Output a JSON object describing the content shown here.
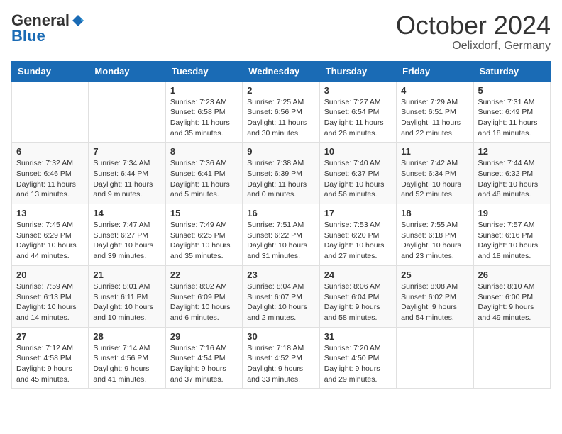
{
  "header": {
    "logo_general": "General",
    "logo_blue": "Blue",
    "month_title": "October 2024",
    "location": "Oelixdorf, Germany"
  },
  "weekdays": [
    "Sunday",
    "Monday",
    "Tuesday",
    "Wednesday",
    "Thursday",
    "Friday",
    "Saturday"
  ],
  "weeks": [
    [
      {
        "day": "",
        "sunrise": "",
        "sunset": "",
        "daylight": ""
      },
      {
        "day": "",
        "sunrise": "",
        "sunset": "",
        "daylight": ""
      },
      {
        "day": "1",
        "sunrise": "Sunrise: 7:23 AM",
        "sunset": "Sunset: 6:58 PM",
        "daylight": "Daylight: 11 hours and 35 minutes."
      },
      {
        "day": "2",
        "sunrise": "Sunrise: 7:25 AM",
        "sunset": "Sunset: 6:56 PM",
        "daylight": "Daylight: 11 hours and 30 minutes."
      },
      {
        "day": "3",
        "sunrise": "Sunrise: 7:27 AM",
        "sunset": "Sunset: 6:54 PM",
        "daylight": "Daylight: 11 hours and 26 minutes."
      },
      {
        "day": "4",
        "sunrise": "Sunrise: 7:29 AM",
        "sunset": "Sunset: 6:51 PM",
        "daylight": "Daylight: 11 hours and 22 minutes."
      },
      {
        "day": "5",
        "sunrise": "Sunrise: 7:31 AM",
        "sunset": "Sunset: 6:49 PM",
        "daylight": "Daylight: 11 hours and 18 minutes."
      }
    ],
    [
      {
        "day": "6",
        "sunrise": "Sunrise: 7:32 AM",
        "sunset": "Sunset: 6:46 PM",
        "daylight": "Daylight: 11 hours and 13 minutes."
      },
      {
        "day": "7",
        "sunrise": "Sunrise: 7:34 AM",
        "sunset": "Sunset: 6:44 PM",
        "daylight": "Daylight: 11 hours and 9 minutes."
      },
      {
        "day": "8",
        "sunrise": "Sunrise: 7:36 AM",
        "sunset": "Sunset: 6:41 PM",
        "daylight": "Daylight: 11 hours and 5 minutes."
      },
      {
        "day": "9",
        "sunrise": "Sunrise: 7:38 AM",
        "sunset": "Sunset: 6:39 PM",
        "daylight": "Daylight: 11 hours and 0 minutes."
      },
      {
        "day": "10",
        "sunrise": "Sunrise: 7:40 AM",
        "sunset": "Sunset: 6:37 PM",
        "daylight": "Daylight: 10 hours and 56 minutes."
      },
      {
        "day": "11",
        "sunrise": "Sunrise: 7:42 AM",
        "sunset": "Sunset: 6:34 PM",
        "daylight": "Daylight: 10 hours and 52 minutes."
      },
      {
        "day": "12",
        "sunrise": "Sunrise: 7:44 AM",
        "sunset": "Sunset: 6:32 PM",
        "daylight": "Daylight: 10 hours and 48 minutes."
      }
    ],
    [
      {
        "day": "13",
        "sunrise": "Sunrise: 7:45 AM",
        "sunset": "Sunset: 6:29 PM",
        "daylight": "Daylight: 10 hours and 44 minutes."
      },
      {
        "day": "14",
        "sunrise": "Sunrise: 7:47 AM",
        "sunset": "Sunset: 6:27 PM",
        "daylight": "Daylight: 10 hours and 39 minutes."
      },
      {
        "day": "15",
        "sunrise": "Sunrise: 7:49 AM",
        "sunset": "Sunset: 6:25 PM",
        "daylight": "Daylight: 10 hours and 35 minutes."
      },
      {
        "day": "16",
        "sunrise": "Sunrise: 7:51 AM",
        "sunset": "Sunset: 6:22 PM",
        "daylight": "Daylight: 10 hours and 31 minutes."
      },
      {
        "day": "17",
        "sunrise": "Sunrise: 7:53 AM",
        "sunset": "Sunset: 6:20 PM",
        "daylight": "Daylight: 10 hours and 27 minutes."
      },
      {
        "day": "18",
        "sunrise": "Sunrise: 7:55 AM",
        "sunset": "Sunset: 6:18 PM",
        "daylight": "Daylight: 10 hours and 23 minutes."
      },
      {
        "day": "19",
        "sunrise": "Sunrise: 7:57 AM",
        "sunset": "Sunset: 6:16 PM",
        "daylight": "Daylight: 10 hours and 18 minutes."
      }
    ],
    [
      {
        "day": "20",
        "sunrise": "Sunrise: 7:59 AM",
        "sunset": "Sunset: 6:13 PM",
        "daylight": "Daylight: 10 hours and 14 minutes."
      },
      {
        "day": "21",
        "sunrise": "Sunrise: 8:01 AM",
        "sunset": "Sunset: 6:11 PM",
        "daylight": "Daylight: 10 hours and 10 minutes."
      },
      {
        "day": "22",
        "sunrise": "Sunrise: 8:02 AM",
        "sunset": "Sunset: 6:09 PM",
        "daylight": "Daylight: 10 hours and 6 minutes."
      },
      {
        "day": "23",
        "sunrise": "Sunrise: 8:04 AM",
        "sunset": "Sunset: 6:07 PM",
        "daylight": "Daylight: 10 hours and 2 minutes."
      },
      {
        "day": "24",
        "sunrise": "Sunrise: 8:06 AM",
        "sunset": "Sunset: 6:04 PM",
        "daylight": "Daylight: 9 hours and 58 minutes."
      },
      {
        "day": "25",
        "sunrise": "Sunrise: 8:08 AM",
        "sunset": "Sunset: 6:02 PM",
        "daylight": "Daylight: 9 hours and 54 minutes."
      },
      {
        "day": "26",
        "sunrise": "Sunrise: 8:10 AM",
        "sunset": "Sunset: 6:00 PM",
        "daylight": "Daylight: 9 hours and 49 minutes."
      }
    ],
    [
      {
        "day": "27",
        "sunrise": "Sunrise: 7:12 AM",
        "sunset": "Sunset: 4:58 PM",
        "daylight": "Daylight: 9 hours and 45 minutes."
      },
      {
        "day": "28",
        "sunrise": "Sunrise: 7:14 AM",
        "sunset": "Sunset: 4:56 PM",
        "daylight": "Daylight: 9 hours and 41 minutes."
      },
      {
        "day": "29",
        "sunrise": "Sunrise: 7:16 AM",
        "sunset": "Sunset: 4:54 PM",
        "daylight": "Daylight: 9 hours and 37 minutes."
      },
      {
        "day": "30",
        "sunrise": "Sunrise: 7:18 AM",
        "sunset": "Sunset: 4:52 PM",
        "daylight": "Daylight: 9 hours and 33 minutes."
      },
      {
        "day": "31",
        "sunrise": "Sunrise: 7:20 AM",
        "sunset": "Sunset: 4:50 PM",
        "daylight": "Daylight: 9 hours and 29 minutes."
      },
      {
        "day": "",
        "sunrise": "",
        "sunset": "",
        "daylight": ""
      },
      {
        "day": "",
        "sunrise": "",
        "sunset": "",
        "daylight": ""
      }
    ]
  ]
}
